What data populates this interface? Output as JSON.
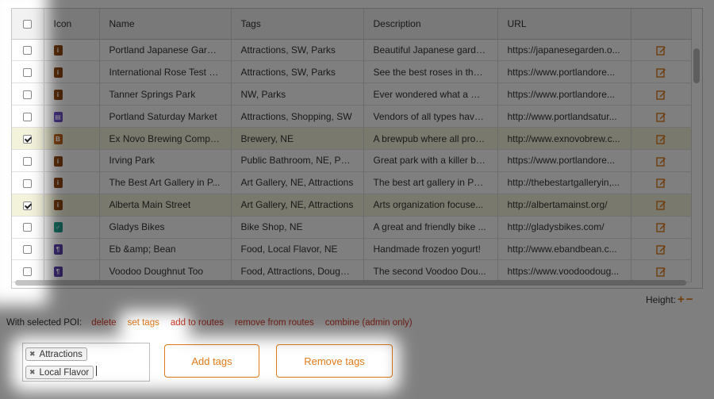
{
  "table": {
    "headers": {
      "icon": "Icon",
      "name": "Name",
      "tags": "Tags",
      "description": "Description",
      "url": "URL"
    },
    "rows": [
      {
        "checked": false,
        "icon_color": "#8b4513",
        "icon": "info-icon",
        "glyph": "i",
        "name": "Portland Japanese Garden",
        "tags": "Attractions, SW, Parks",
        "description": "Beautiful Japanese garde...",
        "url": "https://japanesegarden.o..."
      },
      {
        "checked": false,
        "icon_color": "#8b4513",
        "icon": "info-icon",
        "glyph": "i",
        "name": "International Rose Test G...",
        "tags": "Attractions, SW, Parks",
        "description": "See the best roses in the ...",
        "url": "https://www.portlandore..."
      },
      {
        "checked": false,
        "icon_color": "#8b4513",
        "icon": "info-icon",
        "glyph": "i",
        "name": "Tanner Springs Park",
        "tags": "NW, Parks",
        "description": "Ever wondered what a ma...",
        "url": "https://www.portlandore..."
      },
      {
        "checked": false,
        "icon_color": "#6a4cc4",
        "icon": "shop-icon",
        "glyph": "▤",
        "name": "Portland Saturday Market",
        "tags": "Attractions, Shopping, SW",
        "description": "Vendors of all types have ...",
        "url": "http://www.portlandsatur..."
      },
      {
        "checked": true,
        "icon_color": "#b8621b",
        "icon": "beer-icon",
        "glyph": "B",
        "name": "Ex Novo Brewing Company",
        "tags": "Brewery, NE",
        "description": "A brewpub where all profi...",
        "url": "http://www.exnovobrew.c..."
      },
      {
        "checked": false,
        "icon_color": "#8b4513",
        "icon": "info-icon",
        "glyph": "i",
        "name": "Irving Park",
        "tags": "Public Bathroom, NE, Parks",
        "description": "Great park with a killer ba...",
        "url": "https://www.portlandore..."
      },
      {
        "checked": false,
        "icon_color": "#8b4513",
        "icon": "info-icon",
        "glyph": "i",
        "name": "The Best Art Gallery in P...",
        "tags": "Art Gallery, NE, Attractions",
        "description": "The best art gallery in Por...",
        "url": "http://thebestartgalleryin,..."
      },
      {
        "checked": true,
        "icon_color": "#8b4513",
        "icon": "info-icon",
        "glyph": "i",
        "name": "Alberta Main Street",
        "tags": "Art Gallery, NE, Attractions",
        "description": "Arts organization focuse...",
        "url": "http://albertamainst.org/"
      },
      {
        "checked": false,
        "icon_color": "#1f9a8a",
        "icon": "bike-icon",
        "glyph": "♂",
        "name": "Gladys Bikes",
        "tags": "Bike Shop, NE",
        "description": "A great and friendly bike ...",
        "url": "http://gladysbikes.com/"
      },
      {
        "checked": false,
        "icon_color": "#5a3fa8",
        "icon": "food-icon",
        "glyph": "¶",
        "name": "Eb &amp; Bean",
        "tags": "Food, Local Flavor, NE",
        "description": "Handmade frozen yogurt!",
        "url": "http://www.ebandbean.c..."
      },
      {
        "checked": false,
        "icon_color": "#5a3fa8",
        "icon": "food-icon",
        "glyph": "¶",
        "name": "Voodoo Doughnut Too",
        "tags": "Food, Attractions, Dough...",
        "description": "The second Voodoo Dou...",
        "url": "https://www.voodoodoug..."
      }
    ]
  },
  "height_control": {
    "label": "Height:",
    "plus": "+",
    "minus": "−"
  },
  "actions": {
    "label": "With selected POI:",
    "delete": "delete",
    "set_tags": "set tags",
    "add_to_routes": "add to routes",
    "remove_from_routes": "remove from routes",
    "combine": "combine (admin only)"
  },
  "tag_editor": {
    "tags": [
      "Attractions",
      "Local Flavor"
    ],
    "remove_glyph": "✖"
  },
  "buttons": {
    "add_tags": "Add tags",
    "remove_tags": "Remove tags"
  },
  "colors": {
    "accent": "#e07b1a",
    "danger": "#d23a2a",
    "selected_row": "#f3f2db"
  }
}
